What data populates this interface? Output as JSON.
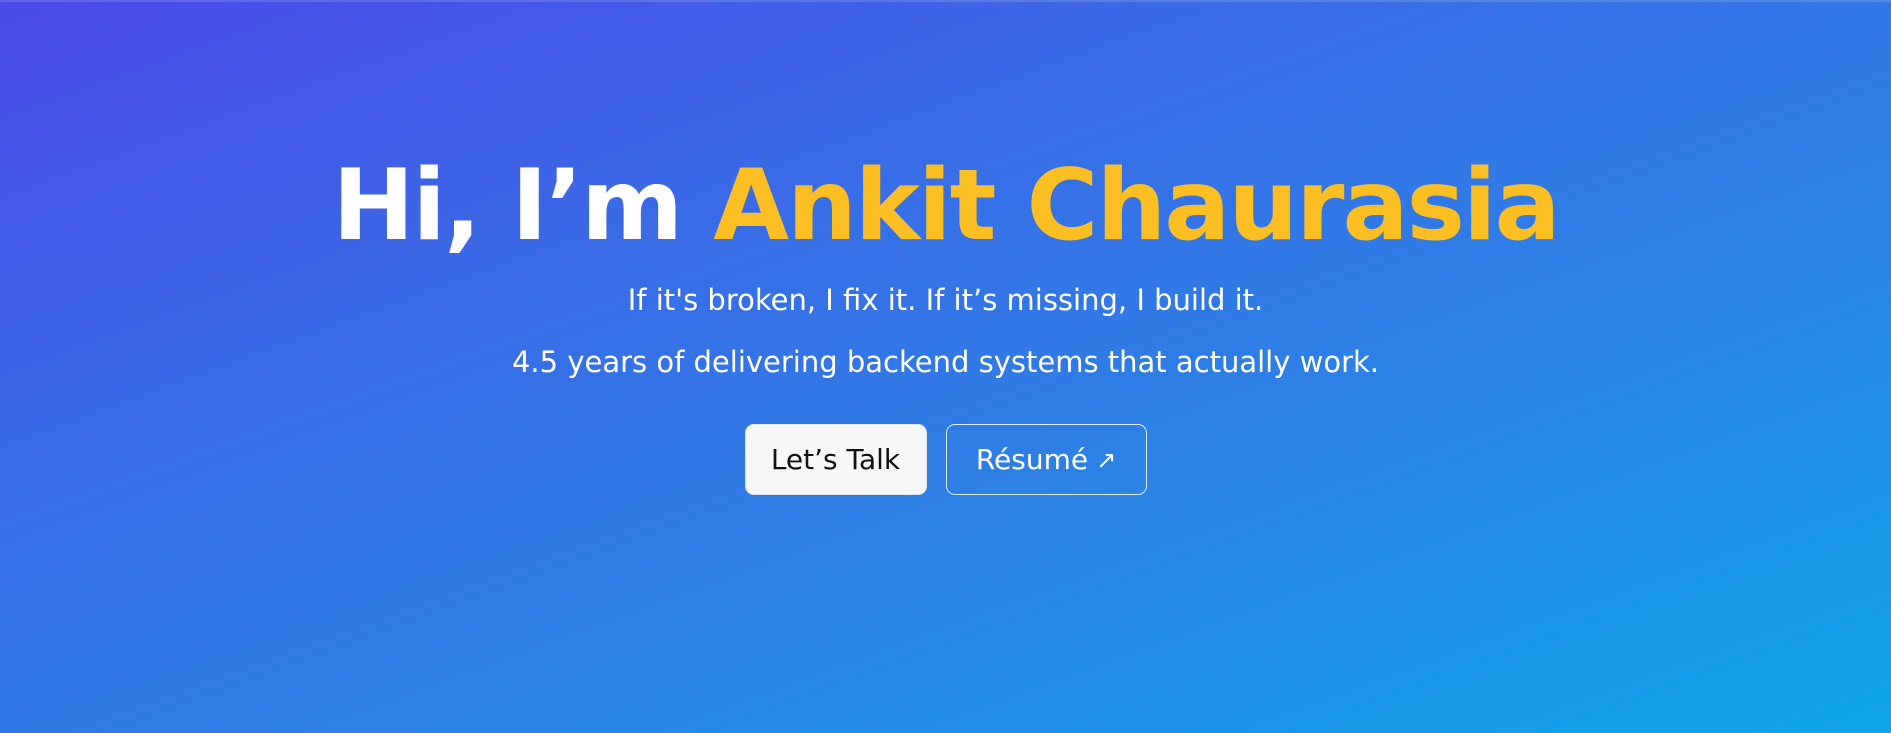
{
  "hero": {
    "greeting": "Hi, I’m ",
    "name": "Ankit Chaurasia",
    "tagline": "If it's broken, I fix it. If it’s missing, I build it.",
    "subline": "4.5 years of delivering backend systems that actually work.",
    "primary_button": "Let’s Talk",
    "secondary_button": "Résumé",
    "secondary_icon": "↗"
  },
  "colors": {
    "gradient_start": "#4b4be8",
    "gradient_end": "#0ea5e9",
    "accent": "#fbbf24",
    "text": "#ffffff",
    "button_bg": "#f7f7f8"
  },
  "icons": {
    "external_link": "external-link-icon"
  }
}
